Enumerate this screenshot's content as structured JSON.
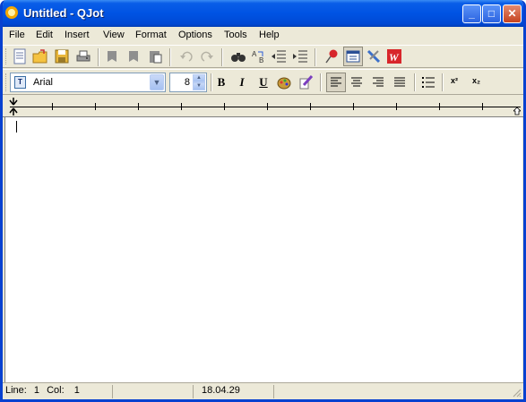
{
  "window": {
    "title": "Untitled - QJot"
  },
  "menu": [
    "File",
    "Edit",
    "Insert",
    "View",
    "Format",
    "Options",
    "Tools",
    "Help"
  ],
  "toolbar1": {
    "icons": [
      "new-document-icon",
      "open-folder-icon",
      "save-icon",
      "print-icon",
      "cut-icon",
      "copy-icon",
      "paste-icon",
      "undo-icon",
      "redo-icon",
      "find-icon",
      "replace-icon",
      "outdent-icon",
      "indent-icon",
      "pin-icon",
      "calendar-icon",
      "tools-icon",
      "word-icon"
    ]
  },
  "format": {
    "font_name": "Arial",
    "font_size": "8",
    "bold_glyph": "B",
    "italic_glyph": "I",
    "underline_glyph": "U",
    "superscript_label": "x²",
    "subscript_label": "x₂"
  },
  "status": {
    "line_label": "Line:",
    "line_value": "1",
    "col_label": "Col:",
    "col_value": "1",
    "time": "18.04.29"
  },
  "colors": {
    "titlebar": "#0053e3",
    "chrome": "#ece9d8"
  }
}
